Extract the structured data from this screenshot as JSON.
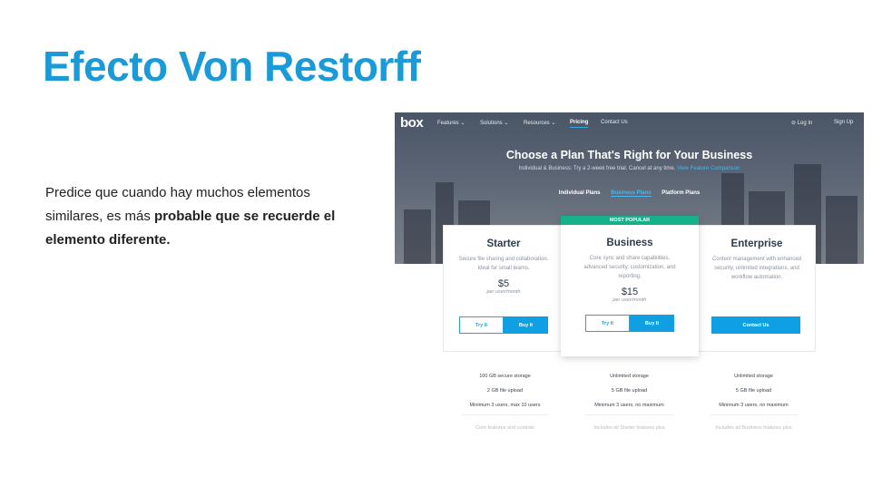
{
  "slide": {
    "title": "Efecto Von Restorff",
    "desc_normal": "Predice que cuando hay muchos elementos similares, es más ",
    "desc_bold": "probable que se recuerde el elemento diferente."
  },
  "nav": {
    "logo": "box",
    "items": [
      "Features ⌄",
      "Solutions ⌄",
      "Resources ⌄",
      "Pricing",
      "Contact Us"
    ],
    "login": "⊖ Log In",
    "signup": "Sign Up"
  },
  "hero": {
    "title": "Choose a Plan That's Right for Your Business",
    "subtitle": "Individual & Business: Try a 2-week free trial. Cancel at any time.",
    "link": "View Feature Comparison",
    "tabs": [
      "Individual Plans",
      "Business Plans",
      "Platform Plans"
    ]
  },
  "plans": [
    {
      "name": "Starter",
      "desc": "Secure file sharing and collaboration. Ideal for small teams.",
      "price": "$5",
      "per": "per user/month",
      "try": "Try It",
      "buy": "Buy It"
    },
    {
      "name": "Business",
      "badge": "MOST POPULAR",
      "desc": "Core sync and share capabilities, advanced security, customization, and reporting.",
      "price": "$15",
      "per": "per user/month",
      "try": "Try It",
      "buy": "Buy It"
    },
    {
      "name": "Enterprise",
      "desc": "Content management with enhanced security, unlimited integrations, and workflow automation.",
      "contact": "Contact Us"
    }
  ],
  "features": [
    [
      "100 GB secure storage",
      "2 GB file upload",
      "Minimum 3 users, max 10 users",
      "Core features and controls"
    ],
    [
      "Unlimited storage",
      "5 GB file upload",
      "Minimum 3 users, no maximum",
      "Includes all Starter features plus"
    ],
    [
      "Unlimited storage",
      "5 GB file upload",
      "Minimum 3 users, no maximum",
      "Includes all Business features plus"
    ]
  ]
}
